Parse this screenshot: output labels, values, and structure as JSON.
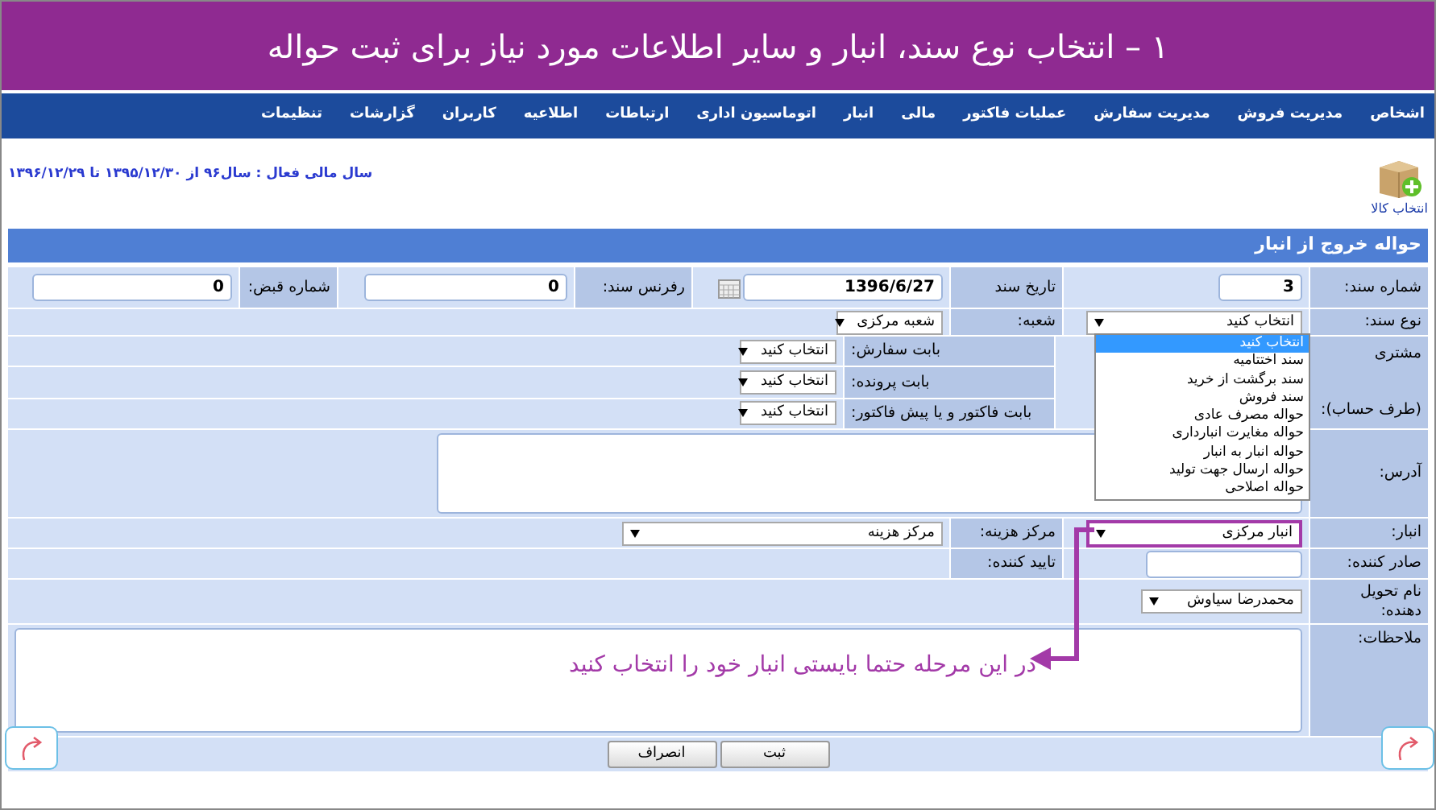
{
  "banner": {
    "title": "۱ – انتخاب نوع سند، انبار و سایر اطلاعات مورد نیاز برای ثبت حواله"
  },
  "nav": [
    "اشخاص",
    "مدیریت فروش",
    "مدیریت سفارش",
    "عملیات فاکتور",
    "مالی",
    "انبار",
    "اتوماسیون اداری",
    "ارتباطات",
    "اطلاعیه",
    "کاربران",
    "گزارشات",
    "تنظیمات"
  ],
  "product_button": {
    "label": "انتخاب کالا"
  },
  "fiscal_year": "سال مالی فعال : سال۹۶ از ۱۳۹۵/۱۲/۳۰ تا ۱۳۹۶/۱۲/۲۹",
  "form": {
    "title": "حواله خروج از انبار",
    "doc_number": {
      "label": "شماره سند:",
      "value": "3"
    },
    "doc_date": {
      "label": "تاریخ سند",
      "value": "1396/6/27"
    },
    "reference": {
      "label": "رفرنس سند:",
      "value": "0"
    },
    "receipt_number": {
      "label": "شماره قبض:",
      "value": "0"
    },
    "doc_type": {
      "label": "نوع سند:",
      "value": "انتخاب کنید"
    },
    "branch": {
      "label": "شعبه:",
      "value": "شعبه مرکزی"
    },
    "customer": {
      "label": "مشتری",
      "sublabel": "(طرف حساب):"
    },
    "sub_fields": [
      {
        "label": "بابت سفارش:",
        "value": "انتخاب کنید"
      },
      {
        "label": "بابت پرونده:",
        "value": "انتخاب کنید"
      },
      {
        "label": "بابت فاکتور و یا پیش فاکتور:",
        "value": "انتخاب کنید"
      }
    ],
    "address": {
      "label": "آدرس:"
    },
    "warehouse": {
      "label": "انبار:",
      "value": "انبار مرکزی",
      "highlighted": true
    },
    "cost_center": {
      "label": "مرکز هزینه:",
      "value": "مرکز هزینه"
    },
    "issuer": {
      "label": "صادر کننده:"
    },
    "approver": {
      "label": "تایید کننده:"
    },
    "deliverer": {
      "label": "نام تحویل دهنده:",
      "value": "محمدرضا سیاوش"
    },
    "notes": {
      "label": "ملاحظات:"
    }
  },
  "doc_type_options": [
    {
      "label": "انتخاب کنید",
      "selected": true
    },
    {
      "label": "سند اختتامیه",
      "selected": false
    },
    {
      "label": "سند برگشت از خرید",
      "selected": false
    },
    {
      "label": "سند فروش",
      "selected": false
    },
    {
      "label": "حواله مصرف عادی",
      "selected": false
    },
    {
      "label": "حواله مغایرت انبارداری",
      "selected": false
    },
    {
      "label": "حواله انبار به انبار",
      "selected": false
    },
    {
      "label": "حواله ارسال جهت تولید",
      "selected": false
    },
    {
      "label": "حواله اصلاحی",
      "selected": false
    }
  ],
  "annotation": {
    "text": "در این مرحله حتما بایستی انبار خود را انتخاب کنید"
  },
  "buttons": [
    "ثبت",
    "انصراف"
  ]
}
